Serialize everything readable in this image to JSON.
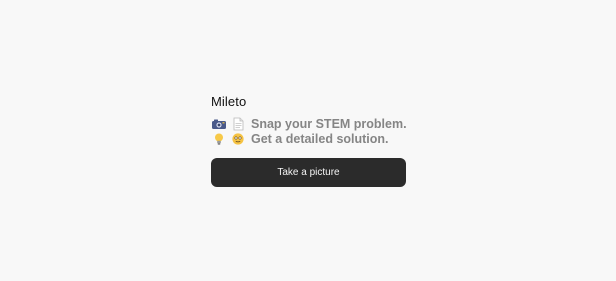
{
  "app": {
    "title": "Mileto"
  },
  "steps": [
    {
      "icon_1": "camera-icon",
      "icon_2": "document-icon",
      "text": "Snap your STEM problem."
    },
    {
      "icon_1": "lightbulb-icon",
      "icon_2": "thinking-face-icon",
      "text": "Get a detailed solution."
    }
  ],
  "actions": {
    "take_picture_label": "Take a picture"
  },
  "colors": {
    "background": "#f8f8f8",
    "button": "#2b2b2b",
    "muted_text": "#858585"
  }
}
